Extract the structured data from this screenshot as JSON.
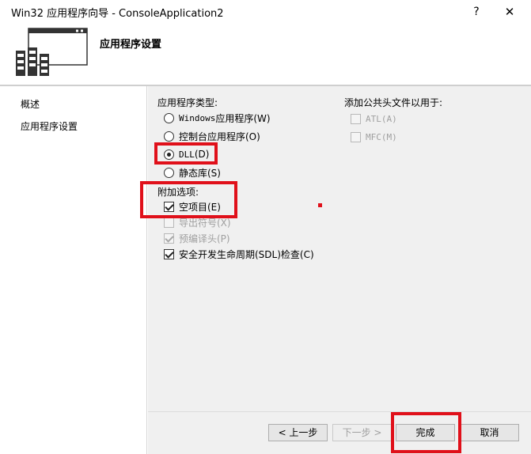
{
  "window": {
    "title": "Win32 应用程序向导 - ConsoleApplication2",
    "help_glyph": "?",
    "close_glyph": "✕"
  },
  "header": {
    "icon": "wizard-window-icon",
    "title": "应用程序设置"
  },
  "sidebar": {
    "items": [
      {
        "label": "概述"
      },
      {
        "label": "应用程序设置"
      }
    ]
  },
  "app_type": {
    "label": "应用程序类型:",
    "options": [
      {
        "prefix": "Windows ",
        "text": "应用程序(W)",
        "selected": false
      },
      {
        "prefix": "",
        "text": "控制台应用程序(O)",
        "selected": false
      },
      {
        "prefix": "DLL",
        "text": "(D)",
        "selected": true
      },
      {
        "prefix": "",
        "text": "静态库(S)",
        "selected": false
      }
    ]
  },
  "extra_options": {
    "label": "附加选项:",
    "items": [
      {
        "text": "空项目(E)",
        "checked": true,
        "enabled": true
      },
      {
        "text": "导出符号(X)",
        "checked": false,
        "enabled": false
      },
      {
        "text": "预编译头(P)",
        "checked": true,
        "enabled": false
      },
      {
        "text": "安全开发生命周期(SDL)检查(C)",
        "checked": true,
        "enabled": true
      }
    ]
  },
  "common_headers": {
    "label": "添加公共头文件以用于:",
    "items": [
      {
        "text": "ATL(A)",
        "checked": false,
        "enabled": false
      },
      {
        "text": "MFC(M)",
        "checked": false,
        "enabled": false
      }
    ]
  },
  "buttons": {
    "prev": "< 上一步",
    "next": "下一步 >",
    "finish": "完成",
    "cancel": "取消"
  },
  "colors": {
    "annotation": "#e0101a",
    "panel": "#f0f0f0"
  }
}
